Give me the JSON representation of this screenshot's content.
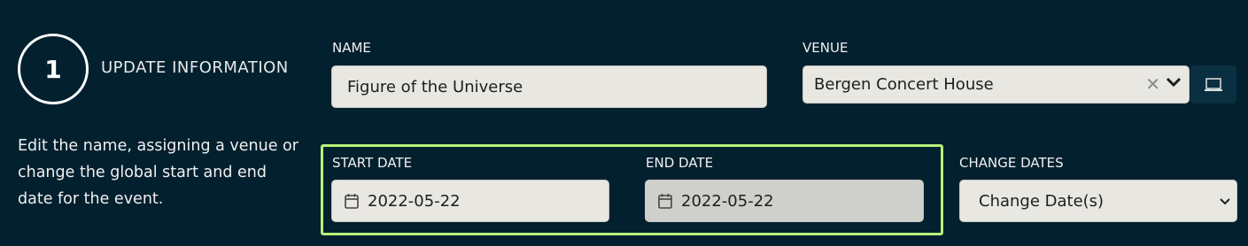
{
  "step": {
    "number": "1",
    "title": "UPDATE INFORMATION",
    "description": "Edit the name, assigning a venue or change the global start and end date for the event."
  },
  "name_field": {
    "label": "NAME",
    "value": "Figure of the Universe"
  },
  "venue_field": {
    "label": "VENUE",
    "value": "Bergen Concert House",
    "clear_symbol": "✕"
  },
  "start_date": {
    "label": "START DATE",
    "value": "2022-05-22"
  },
  "end_date": {
    "label": "END DATE",
    "value": "2022-05-22"
  },
  "change_dates": {
    "label": "CHANGE DATES",
    "selected": "Change Date(s)"
  },
  "colors": {
    "background": "#03202f",
    "highlight_border": "#b7f27a",
    "input_bg": "#e8e7e1"
  },
  "icons": [
    "calendar-icon",
    "chevron-down-icon",
    "clear-icon",
    "venue-map-icon"
  ]
}
